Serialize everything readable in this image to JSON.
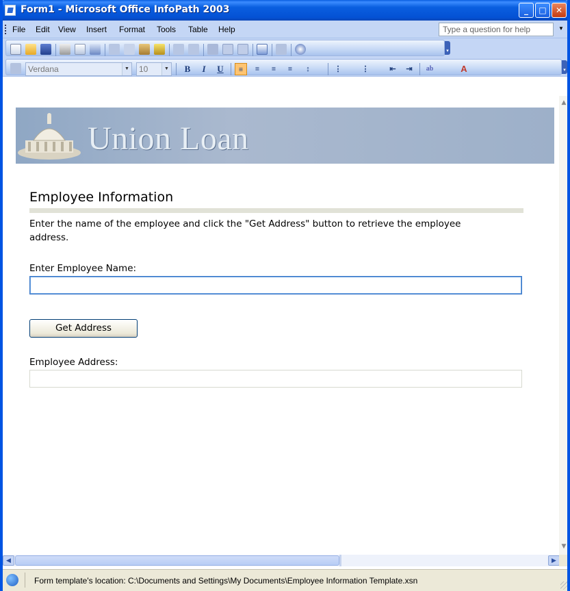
{
  "window": {
    "title": "Form1 - Microsoft Office InfoPath 2003"
  },
  "menubar": {
    "items": [
      "File",
      "Edit",
      "View",
      "Insert",
      "Format",
      "Tools",
      "Table",
      "Help"
    ],
    "help_placeholder": "Type a question for help"
  },
  "formatting_toolbar": {
    "font_name": "Verdana",
    "font_size": "10",
    "bold_label": "B",
    "italic_label": "I",
    "underline_label": "U"
  },
  "form": {
    "banner_text": "Union Loan",
    "section_title": "Employee Information",
    "description": "Enter the name of the employee and click the \"Get Address\" button to retrieve the employee address.",
    "name_label": "Enter Employee Name:",
    "name_value": "",
    "button_label": "Get Address",
    "address_label": "Employee Address:",
    "address_value": ""
  },
  "statusbar": {
    "text": "Form template's location: C:\\Documents and Settings\\My Documents\\Employee Information Template.xsn"
  },
  "colors": {
    "titlebar": "#0a5fe0",
    "toolbar_bg": "#c4d6f5",
    "active_align": "#ffc471",
    "banner": "#9db0c9",
    "rule": "#e1e2d7"
  },
  "icons": {
    "title": "infopath-form-icon",
    "status": "form-template-icon"
  }
}
